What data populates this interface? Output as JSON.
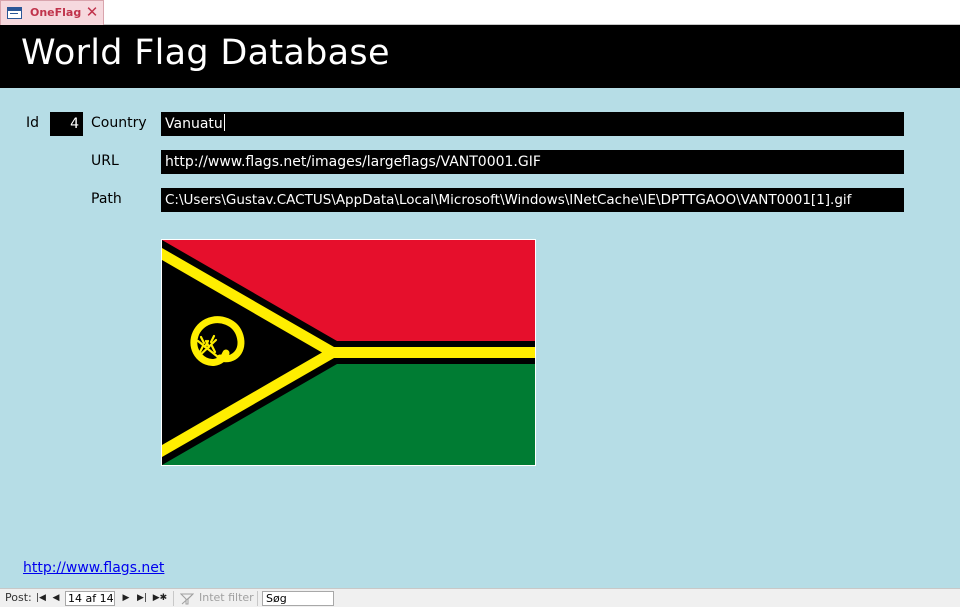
{
  "tab": {
    "label": "OneFlag",
    "icon": "form-icon"
  },
  "header": {
    "title": "World Flag Database"
  },
  "form": {
    "id_label": "Id",
    "id_value": "4",
    "country_label": "Country",
    "country_value": "Vanuatu",
    "url_label": "URL",
    "url_value": "http://www.flags.net/images/largeflags/VANT0001.GIF",
    "path_label": "Path",
    "path_value": "C:\\Users\\Gustav.CACTUS\\AppData\\Local\\Microsoft\\Windows\\INetCache\\IE\\DPTTGAOO\\VANT0001[1].gif"
  },
  "flag": {
    "country": "Vanuatu",
    "colors": {
      "red": "#e60f2c",
      "green": "#007c33",
      "black": "#000000",
      "yellow": "#ffee00"
    }
  },
  "footer_link": {
    "text": "http://www.flags.net"
  },
  "navigation": {
    "record_label": "Post:",
    "record_position": "14 af 14",
    "filter_label": "Intet filter",
    "search_placeholder": "Søg"
  },
  "colors": {
    "background": "#b6dde6",
    "header_bg": "#000000",
    "field_bg": "#000000",
    "tab_accent": "#c0334b"
  }
}
